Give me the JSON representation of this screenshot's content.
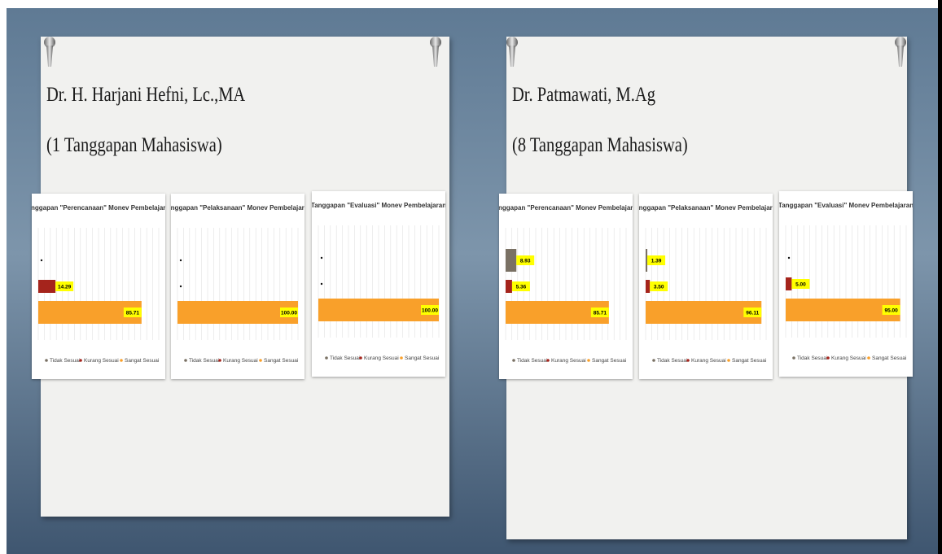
{
  "colors": {
    "tidak_sesuai": "#7a7164",
    "kurang_sesuai": "#a5241c",
    "sangat_sesuai": "#f9a02a",
    "label_highlight": "#ffff00"
  },
  "panels": [
    {
      "name": "Dr. H. Harjani Hefni, Lc.,MA",
      "responses": "(1 Tanggapan Mahasiswa)"
    },
    {
      "name": "Dr. Patmawati, M.Ag",
      "responses": "(8 Tanggapan Mahasiswa)"
    }
  ],
  "legend_labels": [
    "Tidak Sesuai",
    "Kurang Sesuai",
    "Sangat Sesuai"
  ],
  "chart_data": [
    {
      "type": "bar",
      "orientation": "horizontal",
      "title": "Tanggapan \"Perencanaan\" Monev Pembelajaran",
      "series": [
        {
          "name": "Tidak Sesuai",
          "value": 0,
          "label": ""
        },
        {
          "name": "Kurang Sesuai",
          "value": 14.29,
          "label": "14.29"
        },
        {
          "name": "Sangat Sesuai",
          "value": 85.71,
          "label": "85.71"
        }
      ],
      "xlim": [
        0,
        100
      ],
      "legend": "bottom",
      "grid": true
    },
    {
      "type": "bar",
      "orientation": "horizontal",
      "title": "Tanggapan \"Pelaksanaan\" Monev Pembelajaran",
      "series": [
        {
          "name": "Tidak Sesuai",
          "value": 0,
          "label": ""
        },
        {
          "name": "Kurang Sesuai",
          "value": 0,
          "label": ""
        },
        {
          "name": "Sangat Sesuai",
          "value": 100,
          "label": "100.00"
        }
      ],
      "xlim": [
        0,
        100
      ],
      "legend": "bottom",
      "grid": true
    },
    {
      "type": "bar",
      "orientation": "horizontal",
      "title": "Tanggapan \"Evaluasi\" Monev Pembelajaran",
      "series": [
        {
          "name": "Tidak Sesuai",
          "value": 0,
          "label": ""
        },
        {
          "name": "Kurang Sesuai",
          "value": 0,
          "label": ""
        },
        {
          "name": "Sangat Sesuai",
          "value": 100,
          "label": "100.00"
        }
      ],
      "xlim": [
        0,
        100
      ],
      "legend": "bottom",
      "grid": true
    },
    {
      "type": "bar",
      "orientation": "horizontal",
      "title": "Tanggapan \"Perencanaan\" Monev Pembelajaran",
      "series": [
        {
          "name": "Tidak Sesuai",
          "value": 8.93,
          "label": "8.93"
        },
        {
          "name": "Kurang Sesuai",
          "value": 5.36,
          "label": "5.36"
        },
        {
          "name": "Sangat Sesuai",
          "value": 85.71,
          "label": "85.71"
        }
      ],
      "xlim": [
        0,
        100
      ],
      "legend": "bottom",
      "grid": true
    },
    {
      "type": "bar",
      "orientation": "horizontal",
      "title": "Tanggapan \"Pelaksanaan\" Monev Pembelajaran",
      "series": [
        {
          "name": "Tidak Sesuai",
          "value": 1.39,
          "label": "1.39"
        },
        {
          "name": "Kurang Sesuai",
          "value": 3.5,
          "label": "3.50"
        },
        {
          "name": "Sangat Sesuai",
          "value": 96.11,
          "label": "96.11"
        }
      ],
      "xlim": [
        0,
        100
      ],
      "legend": "bottom",
      "grid": true
    },
    {
      "type": "bar",
      "orientation": "horizontal",
      "title": "Tanggapan \"Evaluasi\" Monev Pembelajaran",
      "series": [
        {
          "name": "Tidak Sesuai",
          "value": 0,
          "label": ""
        },
        {
          "name": "Kurang Sesuai",
          "value": 5.0,
          "label": "5.00"
        },
        {
          "name": "Sangat Sesuai",
          "value": 95.0,
          "label": "95.00"
        }
      ],
      "xlim": [
        0,
        100
      ],
      "legend": "bottom",
      "grid": true
    }
  ]
}
